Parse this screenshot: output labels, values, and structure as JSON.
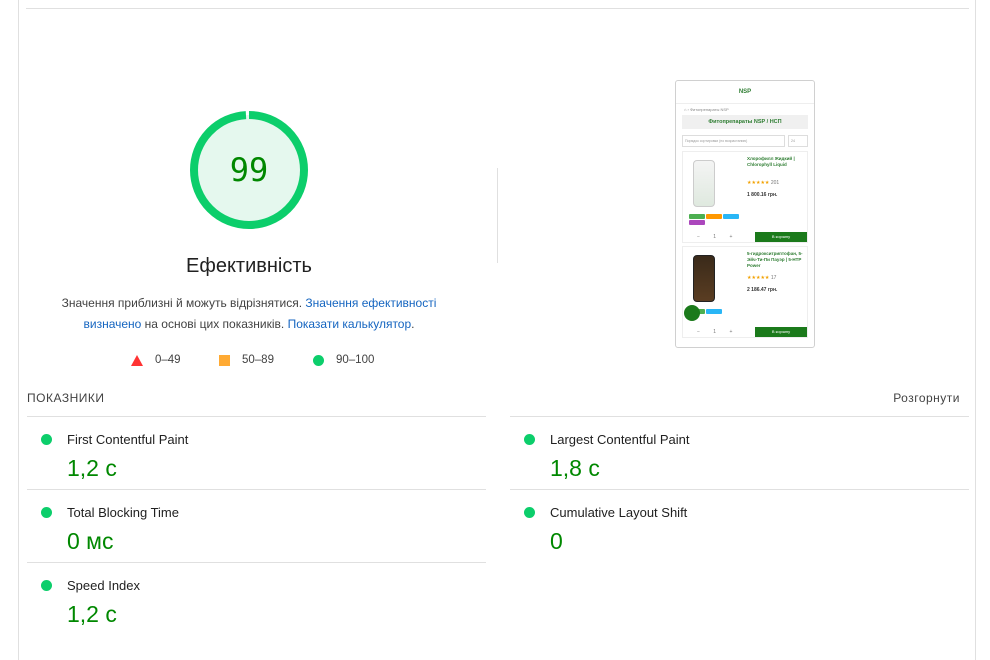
{
  "performance": {
    "score": "99",
    "score_fraction": 0.99,
    "title": "Ефективність",
    "description_prefix": "Значення приблизні й можуть відрізнятися. ",
    "description_link": "Значення ефективності визначено",
    "description_mid": " на основі цих показників. ",
    "calculator_link": "Показати калькулятор",
    "description_suffix": "."
  },
  "legend": [
    {
      "range": "0–49",
      "color": "#ff3333",
      "shape": "triangle"
    },
    {
      "range": "50–89",
      "color": "#ffaa33",
      "shape": "square"
    },
    {
      "range": "90–100",
      "color": "#0cce6b",
      "shape": "circle"
    }
  ],
  "screenshot": {
    "logo": "NSP",
    "breadcrumb": "⌂ › Фитопрепараты NSP",
    "page_title": "Фитопрепараты NSP / НСП",
    "sort_placeholder": "Порядок сортировки (по возрастанию)",
    "per_page": "24",
    "products": [
      {
        "name": "Хлорофилл Жидкий | Chlorophyll Liquid",
        "stars": "★★★★★",
        "reviews": "201",
        "price": "1 800.16 грн.",
        "cart": "В корзину",
        "qty": "− 1 +"
      },
      {
        "name": "5-гидрокситриптофан, 5-Эйч-Ти-Пи Пауэр | 5-HTP Power",
        "stars": "★★★★★",
        "reviews": "17",
        "price": "2 186.47 грн.",
        "cart": "В корзину",
        "qty": "− 1 +"
      }
    ]
  },
  "metrics": {
    "heading": "ПОКАЗНИКИ",
    "expand_label": "Розгорнути",
    "items": [
      {
        "name": "First Contentful Paint",
        "value": "1,2 с",
        "status_color": "#0cce6b"
      },
      {
        "name": "Largest Contentful Paint",
        "value": "1,8 с",
        "status_color": "#0cce6b"
      },
      {
        "name": "Total Blocking Time",
        "value": "0 мс",
        "status_color": "#0cce6b"
      },
      {
        "name": "Cumulative Layout Shift",
        "value": "0",
        "status_color": "#0cce6b"
      },
      {
        "name": "Speed Index",
        "value": "1,2 с",
        "status_color": "#0cce6b"
      }
    ]
  },
  "colors": {
    "pass": "#0cce6b",
    "pass_text": "#008800",
    "link": "#1565c0"
  }
}
